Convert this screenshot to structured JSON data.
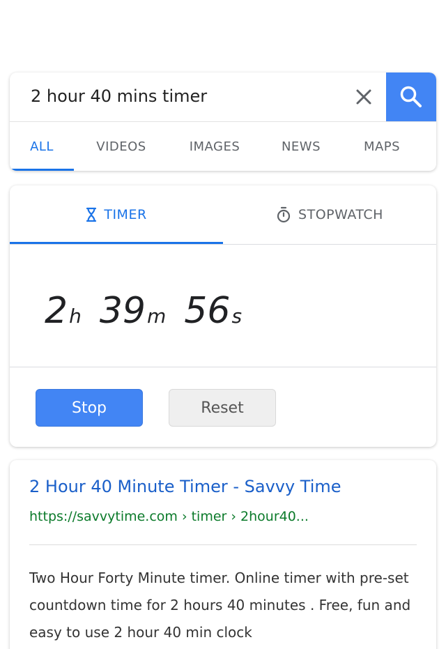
{
  "search": {
    "query": "2 hour 40 mins timer",
    "tabs": [
      {
        "label": "ALL",
        "active": true
      },
      {
        "label": "VIDEOS"
      },
      {
        "label": "IMAGES"
      },
      {
        "label": "NEWS"
      },
      {
        "label": "MAPS"
      }
    ],
    "accent_color": "#4285f4"
  },
  "timer": {
    "tabs": [
      {
        "label": "TIMER",
        "icon": "hourglass-icon",
        "active": true
      },
      {
        "label": "STOPWATCH",
        "icon": "stopwatch-icon"
      }
    ],
    "hours": "2",
    "hours_unit": "h",
    "minutes": "39",
    "minutes_unit": "m",
    "seconds": "56",
    "seconds_unit": "s",
    "stop_label": "Stop",
    "reset_label": "Reset"
  },
  "result": {
    "title": "2 Hour 40 Minute Timer - Savvy Time",
    "url": "https://savvytime.com › timer › 2hour40...",
    "snippet": "Two Hour Forty Minute timer. Online timer with pre-set countdown time for 2 hours 40 minutes . Free, fun and easy to use 2 hour 40 min clock"
  }
}
